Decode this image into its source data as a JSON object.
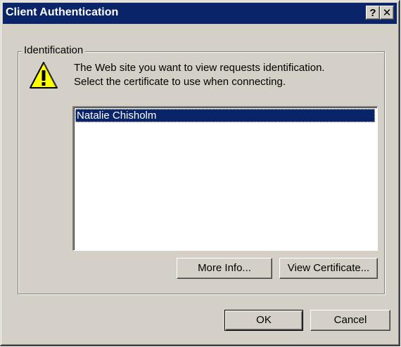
{
  "window": {
    "title": "Client Authentication",
    "help_glyph": "?",
    "close_glyph": "✕"
  },
  "group": {
    "label": "Identification"
  },
  "message": {
    "line1": "The Web site you want to view requests identification.",
    "line2": "Select the certificate to use when connecting."
  },
  "icons": {
    "warning": "warning-triangle-icon",
    "help": "help-icon",
    "close": "close-icon"
  },
  "certificates": {
    "items": [
      "Natalie Chisholm"
    ],
    "selected": "Natalie Chisholm"
  },
  "buttons": {
    "more_info": "More Info...",
    "view_certificate": "View Certificate...",
    "ok": "OK",
    "cancel": "Cancel"
  },
  "colors": {
    "face": "#d4d0c8",
    "title_bar": "#0a246a",
    "selection": "#0a246a",
    "warning_fill": "#ffff00"
  }
}
